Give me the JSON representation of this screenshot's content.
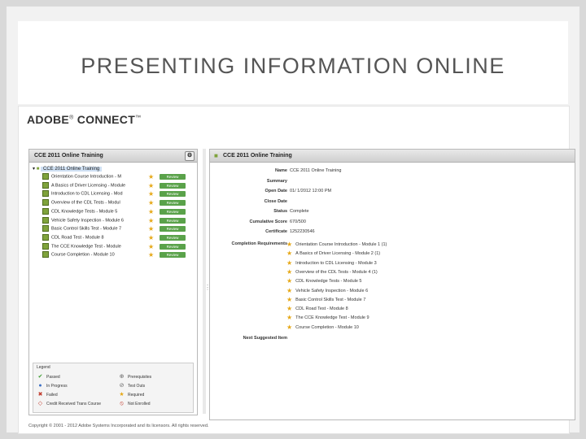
{
  "slide": {
    "title": "PRESENTING INFORMATION ONLINE"
  },
  "brand": {
    "name": "ADOBE",
    "reg": "®",
    "product": " CONNECT",
    "tm": "™"
  },
  "left_panel": {
    "header": "CCE 2011 Online Training",
    "root": "CCE 2011 Online Training",
    "modules": [
      "Orientation Course Introduction - M",
      "A Basics of Driver Licensing - Module",
      "Introduction to CDL Licensing - Mod",
      "Overview of the CDL Tests - Modul",
      "CDL Knowledge Tests - Module 5",
      "Vehicle Safety Inspection - Module 6",
      "Basic Control Skills Test - Module 7",
      "CDL Road Test - Module 8",
      "The CCE Knowledge Test - Module",
      "Course Completion - Module 10"
    ],
    "review_label": "Review"
  },
  "legend": {
    "title": "Legend",
    "items": [
      {
        "icon": "check-icon",
        "label": "Passed"
      },
      {
        "icon": "prerequisites-icon",
        "label": "Prerequisites"
      },
      {
        "icon": "in-progress-icon",
        "label": "In Progress"
      },
      {
        "icon": "test-outs-icon",
        "label": "Test Outs"
      },
      {
        "icon": "failed-icon",
        "label": "Failed"
      },
      {
        "icon": "required-star-icon",
        "label": "Required"
      },
      {
        "icon": "credit-icon",
        "label": "Credit Received Trans Course"
      },
      {
        "icon": "not-enrolled-icon",
        "label": "Not Enrolled"
      }
    ]
  },
  "right_panel": {
    "header": "CCE 2011 Online Training",
    "fields": [
      {
        "label": "Name",
        "value": "CCE 2011 Online Training"
      },
      {
        "label": "Summary",
        "value": ""
      },
      {
        "label": "Open Date",
        "value": "01/ 1/2012 12:00 PM"
      },
      {
        "label": "Close Date",
        "value": ""
      },
      {
        "label": "Status",
        "value": "Complete"
      },
      {
        "label": "Cumulative Score",
        "value": "670/500"
      },
      {
        "label": "Certificate",
        "value": "1252230546"
      }
    ],
    "requirements_label": "Completion Requirements",
    "requirements": [
      "Orientation Course Introduction - Module 1 (1)",
      "A Basics of Driver Licensing - Module 2 (1)",
      "Introduction to CDL Licensing - Module 3",
      "Overview of the CDL Tests - Module 4 (1)",
      "CDL Knowledge Tests - Module 5",
      "Vehicle Safety Inspection - Module 6",
      "Basic Control Skills Test - Module 7",
      "CDL Road Test - Module 8",
      "The CCE Knowledge Test - Module 9",
      "Course Completion - Module 10"
    ],
    "next_label": "Next Suggested Item"
  },
  "footer": "Copyright © 2001 - 2012 Adobe Systems Incorporated and its licensors. All rights reserved.",
  "colors": {
    "review_green": "#5aa24a",
    "star": "#e6a817",
    "selected": "#cfe0f3"
  }
}
